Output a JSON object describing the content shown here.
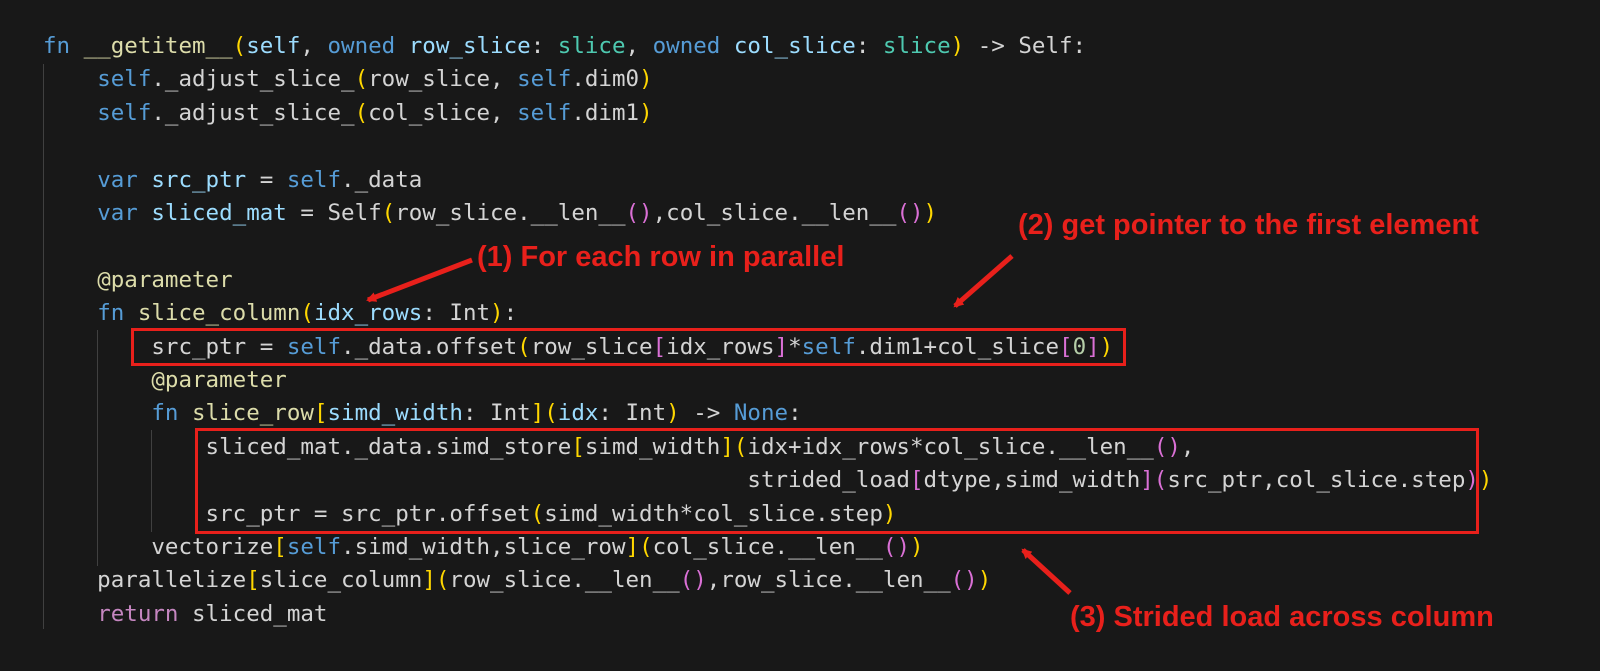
{
  "code": {
    "lines": [
      [
        {
          "t": "fn ",
          "c": "kw"
        },
        {
          "t": "__getitem__",
          "c": "fnc"
        },
        {
          "t": "(",
          "c": "b1"
        },
        {
          "t": "self",
          "c": "prm"
        },
        {
          "t": ", ",
          "c": "pln"
        },
        {
          "t": "owned ",
          "c": "kw"
        },
        {
          "t": "row_slice",
          "c": "prm"
        },
        {
          "t": ": ",
          "c": "pln"
        },
        {
          "t": "slice",
          "c": "typ"
        },
        {
          "t": ", ",
          "c": "pln"
        },
        {
          "t": "owned ",
          "c": "kw"
        },
        {
          "t": "col_slice",
          "c": "prm"
        },
        {
          "t": ": ",
          "c": "pln"
        },
        {
          "t": "slice",
          "c": "typ"
        },
        {
          "t": ")",
          "c": "b1"
        },
        {
          "t": " -> Self:",
          "c": "pln"
        }
      ],
      [
        {
          "t": "    ",
          "c": "pln"
        },
        {
          "t": "self",
          "c": "slf"
        },
        {
          "t": "._adjust_slice_",
          "c": "pln"
        },
        {
          "t": "(",
          "c": "b1"
        },
        {
          "t": "row_slice, ",
          "c": "pln"
        },
        {
          "t": "self",
          "c": "slf"
        },
        {
          "t": ".dim0",
          "c": "pln"
        },
        {
          "t": ")",
          "c": "b1"
        }
      ],
      [
        {
          "t": "    ",
          "c": "pln"
        },
        {
          "t": "self",
          "c": "slf"
        },
        {
          "t": "._adjust_slice_",
          "c": "pln"
        },
        {
          "t": "(",
          "c": "b1"
        },
        {
          "t": "col_slice, ",
          "c": "pln"
        },
        {
          "t": "self",
          "c": "slf"
        },
        {
          "t": ".dim1",
          "c": "pln"
        },
        {
          "t": ")",
          "c": "b1"
        }
      ],
      [],
      [
        {
          "t": "    ",
          "c": "pln"
        },
        {
          "t": "var ",
          "c": "kw"
        },
        {
          "t": "src_ptr",
          "c": "prm"
        },
        {
          "t": " = ",
          "c": "pln"
        },
        {
          "t": "self",
          "c": "slf"
        },
        {
          "t": "._data",
          "c": "pln"
        }
      ],
      [
        {
          "t": "    ",
          "c": "pln"
        },
        {
          "t": "var ",
          "c": "kw"
        },
        {
          "t": "sliced_mat",
          "c": "prm"
        },
        {
          "t": " = Self",
          "c": "pln"
        },
        {
          "t": "(",
          "c": "b1"
        },
        {
          "t": "row_slice.__len__",
          "c": "pln"
        },
        {
          "t": "()",
          "c": "b2"
        },
        {
          "t": ",col_slice.__len__",
          "c": "pln"
        },
        {
          "t": "()",
          "c": "b2"
        },
        {
          "t": ")",
          "c": "b1"
        }
      ],
      [],
      [
        {
          "t": "    ",
          "c": "pln"
        },
        {
          "t": "@parameter",
          "c": "fnc"
        }
      ],
      [
        {
          "t": "    ",
          "c": "pln"
        },
        {
          "t": "fn ",
          "c": "kw"
        },
        {
          "t": "slice_column",
          "c": "fnc"
        },
        {
          "t": "(",
          "c": "b1"
        },
        {
          "t": "idx_rows",
          "c": "prm"
        },
        {
          "t": ": Int",
          "c": "pln"
        },
        {
          "t": ")",
          "c": "b1"
        },
        {
          "t": ":",
          "c": "pln"
        }
      ],
      [
        {
          "t": "        src_ptr = ",
          "c": "pln"
        },
        {
          "t": "self",
          "c": "slf"
        },
        {
          "t": "._data.offset",
          "c": "pln"
        },
        {
          "t": "(",
          "c": "b1"
        },
        {
          "t": "row_slice",
          "c": "pln"
        },
        {
          "t": "[",
          "c": "b2"
        },
        {
          "t": "idx_rows",
          "c": "pln"
        },
        {
          "t": "]",
          "c": "b2"
        },
        {
          "t": "*",
          "c": "pln"
        },
        {
          "t": "self",
          "c": "slf"
        },
        {
          "t": ".dim1+col_slice",
          "c": "pln"
        },
        {
          "t": "[",
          "c": "b2"
        },
        {
          "t": "0",
          "c": "num"
        },
        {
          "t": "]",
          "c": "b2"
        },
        {
          "t": ")",
          "c": "b1"
        }
      ],
      [
        {
          "t": "        ",
          "c": "pln"
        },
        {
          "t": "@parameter",
          "c": "fnc"
        }
      ],
      [
        {
          "t": "        ",
          "c": "pln"
        },
        {
          "t": "fn ",
          "c": "kw"
        },
        {
          "t": "slice_row",
          "c": "fnc"
        },
        {
          "t": "[",
          "c": "b1"
        },
        {
          "t": "simd_width",
          "c": "prm"
        },
        {
          "t": ": Int",
          "c": "pln"
        },
        {
          "t": "]",
          "c": "b1"
        },
        {
          "t": "(",
          "c": "b1"
        },
        {
          "t": "idx",
          "c": "prm"
        },
        {
          "t": ": Int",
          "c": "pln"
        },
        {
          "t": ")",
          "c": "b1"
        },
        {
          "t": " -> ",
          "c": "pln"
        },
        {
          "t": "None",
          "c": "kw"
        },
        {
          "t": ":",
          "c": "pln"
        }
      ],
      [
        {
          "t": "            sliced_mat._data.simd_store",
          "c": "pln"
        },
        {
          "t": "[",
          "c": "b1"
        },
        {
          "t": "simd_width",
          "c": "pln"
        },
        {
          "t": "]",
          "c": "b1"
        },
        {
          "t": "(",
          "c": "b1"
        },
        {
          "t": "idx+idx_rows*col_slice.__len__",
          "c": "pln"
        },
        {
          "t": "()",
          "c": "b2"
        },
        {
          "t": ",",
          "c": "pln"
        }
      ],
      [
        {
          "t": "                                                    strided_load",
          "c": "pln"
        },
        {
          "t": "[",
          "c": "b2"
        },
        {
          "t": "dtype,simd_width",
          "c": "pln"
        },
        {
          "t": "]",
          "c": "b2"
        },
        {
          "t": "(",
          "c": "b2"
        },
        {
          "t": "src_ptr,col_slice.step",
          "c": "pln"
        },
        {
          "t": ")",
          "c": "b2"
        },
        {
          "t": ")",
          "c": "b1"
        }
      ],
      [
        {
          "t": "            src_ptr = src_ptr.offset",
          "c": "pln"
        },
        {
          "t": "(",
          "c": "b1"
        },
        {
          "t": "simd_width*col_slice.step",
          "c": "pln"
        },
        {
          "t": ")",
          "c": "b1"
        }
      ],
      [
        {
          "t": "        vectorize",
          "c": "pln"
        },
        {
          "t": "[",
          "c": "b1"
        },
        {
          "t": "self",
          "c": "slf"
        },
        {
          "t": ".simd_width,slice_row",
          "c": "pln"
        },
        {
          "t": "]",
          "c": "b1"
        },
        {
          "t": "(",
          "c": "b1"
        },
        {
          "t": "col_slice.__len__",
          "c": "pln"
        },
        {
          "t": "()",
          "c": "b2"
        },
        {
          "t": ")",
          "c": "b1"
        }
      ],
      [
        {
          "t": "    parallelize",
          "c": "pln"
        },
        {
          "t": "[",
          "c": "b1"
        },
        {
          "t": "slice_column",
          "c": "pln"
        },
        {
          "t": "]",
          "c": "b1"
        },
        {
          "t": "(",
          "c": "b1"
        },
        {
          "t": "row_slice.__len__",
          "c": "pln"
        },
        {
          "t": "()",
          "c": "b2"
        },
        {
          "t": ",row_slice.__len__",
          "c": "pln"
        },
        {
          "t": "()",
          "c": "b2"
        },
        {
          "t": ")",
          "c": "b1"
        }
      ],
      [
        {
          "t": "    ",
          "c": "pln"
        },
        {
          "t": "return ",
          "c": "ctl"
        },
        {
          "t": "sliced_mat",
          "c": "pln"
        }
      ]
    ]
  },
  "annotations": {
    "a1": "(1) For each row in parallel",
    "a2": "(2) get pointer to the first element",
    "a3": "(3) Strided load across column"
  },
  "colors": {
    "background": "#181818",
    "annotation": "#e8201b",
    "box_border": "#e8201b",
    "indent_guide": "#404040"
  }
}
